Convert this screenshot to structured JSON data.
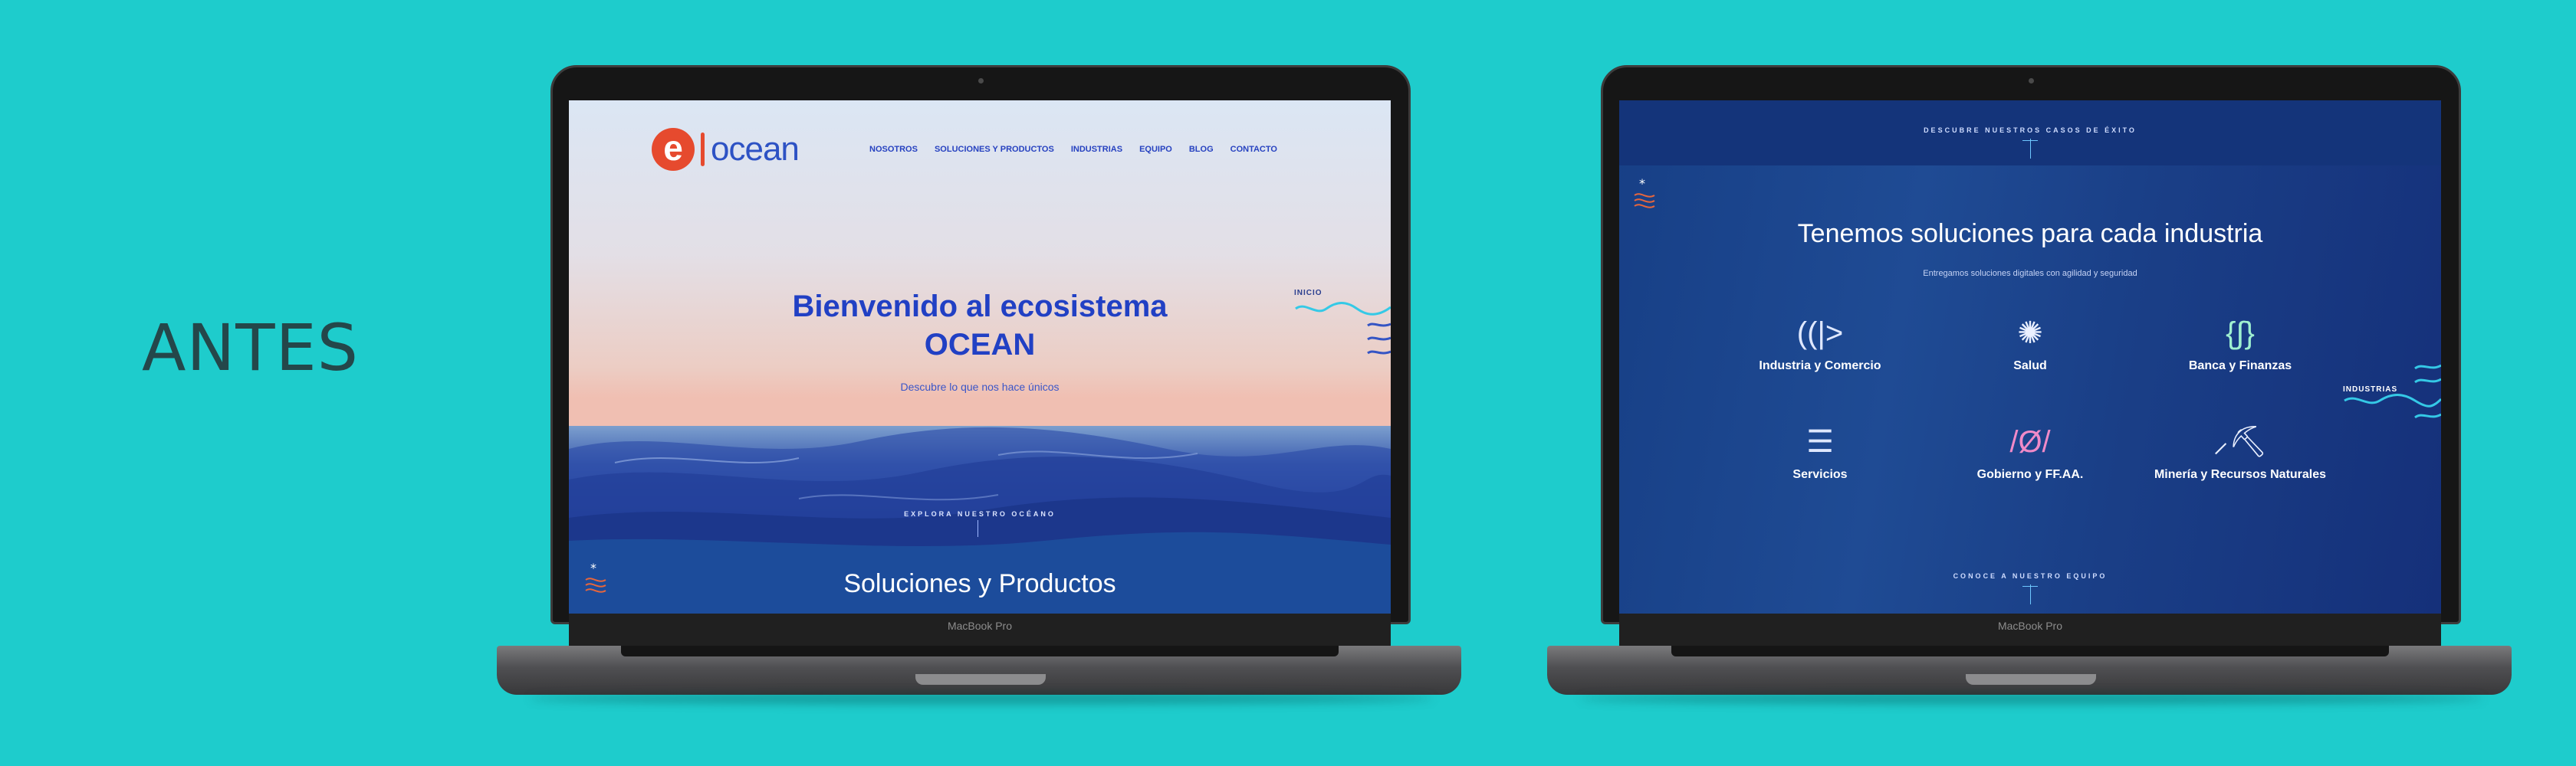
{
  "heading": "ANTES",
  "device_label": "MacBook Pro",
  "screen_left": {
    "logo": {
      "mark": "e",
      "text": "ocean"
    },
    "nav": [
      "NOSOTROS",
      "SOLUCIONES Y PRODUCTOS",
      "INDUSTRIAS",
      "EQUIPO",
      "BLOG",
      "CONTACTO"
    ],
    "hero_title_line1": "Bienvenido al ecosistema",
    "hero_title_line2": "OCEAN",
    "hero_subtitle": "Descubre lo que nos hace únicos",
    "side_label": "INICIO",
    "explore_label": "EXPLORA NUESTRO OCÉANO",
    "next_section_title": "Soluciones y Productos"
  },
  "screen_right": {
    "top_label": "DESCUBRE NUESTROS CASOS DE ÉXITO",
    "title": "Tenemos soluciones para cada industria",
    "subtitle": "Entregamos soluciones digitales con agilidad y seguridad",
    "side_label": "INDUSTRIAS",
    "industries": [
      {
        "icon": "signal-arrow-icon",
        "label": "Industria y Comercio"
      },
      {
        "icon": "health-burst-icon",
        "label": "Salud"
      },
      {
        "icon": "curly-braces-icon",
        "label": "Banca y Finanzas"
      },
      {
        "icon": "server-stack-icon",
        "label": "Servicios"
      },
      {
        "icon": "government-icon",
        "label": "Gobierno y FF.AA."
      },
      {
        "icon": "pickaxe-icon",
        "label": "Minería y Recursos Naturales"
      }
    ],
    "bottom_label": "CONOCE A NUESTRO EQUIPO"
  },
  "colors": {
    "background": "#1ecccc",
    "accent_blue": "#2140c4",
    "accent_orange": "#e64a2e",
    "cyan": "#35c9e6"
  }
}
